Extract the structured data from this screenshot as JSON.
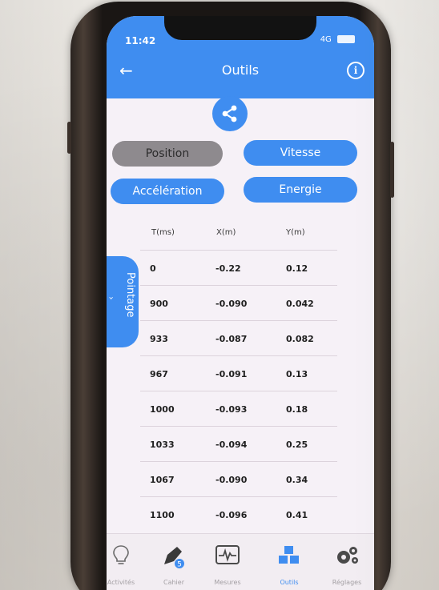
{
  "status": {
    "time": "11:42",
    "indicator": "4G"
  },
  "header": {
    "title": "Outils",
    "back_icon": "arrow-left-icon",
    "info_icon": "info-icon"
  },
  "share": {
    "icon": "share-icon"
  },
  "modes": {
    "position": "Position",
    "vitesse": "Vitesse",
    "acceleration": "Accélération",
    "energie": "Energie",
    "active": "position"
  },
  "table": {
    "columns": [
      "T(ms)",
      "X(m)",
      "Y(m)"
    ],
    "rows": [
      [
        "0",
        "-0.22",
        "0.12"
      ],
      [
        "900",
        "-0.090",
        "0.042"
      ],
      [
        "933",
        "-0.087",
        "0.082"
      ],
      [
        "967",
        "-0.091",
        "0.13"
      ],
      [
        "1000",
        "-0.093",
        "0.18"
      ],
      [
        "1033",
        "-0.094",
        "0.25"
      ],
      [
        "1067",
        "-0.090",
        "0.34"
      ],
      [
        "1100",
        "-0.096",
        "0.41"
      ]
    ]
  },
  "side_tab": {
    "label": "Pointage",
    "icon": "chevron-icon"
  },
  "nav": [
    {
      "label": "Activités",
      "icon": "lightbulb-icon"
    },
    {
      "label": "Cahier",
      "icon": "pen-icon"
    },
    {
      "label": "Mesures",
      "icon": "waveform-icon"
    },
    {
      "label": "Outils",
      "icon": "cubes-icon"
    },
    {
      "label": "Réglages",
      "icon": "gears-icon"
    }
  ],
  "colors": {
    "accent": "#3f8df0",
    "inactive_pill": "#8e8a8e",
    "screen_bg": "#f6f1f7"
  }
}
